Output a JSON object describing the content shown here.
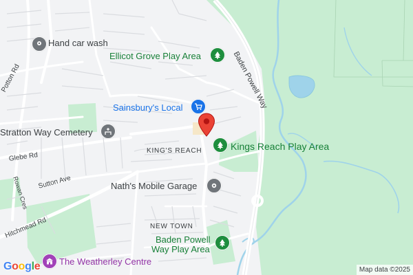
{
  "places": {
    "hand_car_wash": "Hand car wash",
    "ellicot_grove": "Ellicot Grove Play Area",
    "sainsburys": "Sainsbury's Local",
    "stratton_cemetery": "Stratton Way Cemetery",
    "kings_reach_play": "Kings Reach Play Area",
    "naths_garage": "Nath's Mobile Garage",
    "baden_powell_play_line1": "Baden Powell",
    "baden_powell_play_line2": "Way Play Area",
    "weatherley_centre": "The Weatherley Centre"
  },
  "areas": {
    "kings_reach": "KING'S REACH",
    "new_town": "NEW TOWN"
  },
  "streets": {
    "potton_rd": "Potton Rd",
    "rowan_cres": "Rowan Cres",
    "glebe_rd": "Glebe Rd",
    "sutton_ave": "Sutton Ave",
    "hitchmead_rd": "Hitchmead Rd",
    "baden_powell_way": "Baden Powell Way"
  },
  "branding": {
    "logo_letters": [
      "G",
      "o",
      "o",
      "g",
      "l",
      "e"
    ],
    "logo_colors": [
      "#4285F4",
      "#EA4335",
      "#FBBC05",
      "#4285F4",
      "#34A853",
      "#EA4335"
    ]
  },
  "attribution": "Map data ©2025",
  "colors": {
    "park_green": "#c7ecd0",
    "water_blue": "#9fd3ea",
    "pin_red": "#ea4335",
    "park_icon_green": "#1e8e3e",
    "shop_icon_blue": "#1a73e8",
    "gray_icon": "#70757a",
    "purple_icon": "#a142b8"
  },
  "icons": {
    "hand_car_wash": "map-pin-icon",
    "ellicot_grove": "tree-icon",
    "sainsburys": "shopping-cart-icon",
    "stratton_cemetery": "cemetery-icon",
    "kings_reach_play": "tree-icon",
    "naths_garage": "map-pin-icon",
    "baden_powell_play": "tree-icon",
    "weatherley_centre": "building-icon",
    "selected_location": "location-pin-icon"
  }
}
